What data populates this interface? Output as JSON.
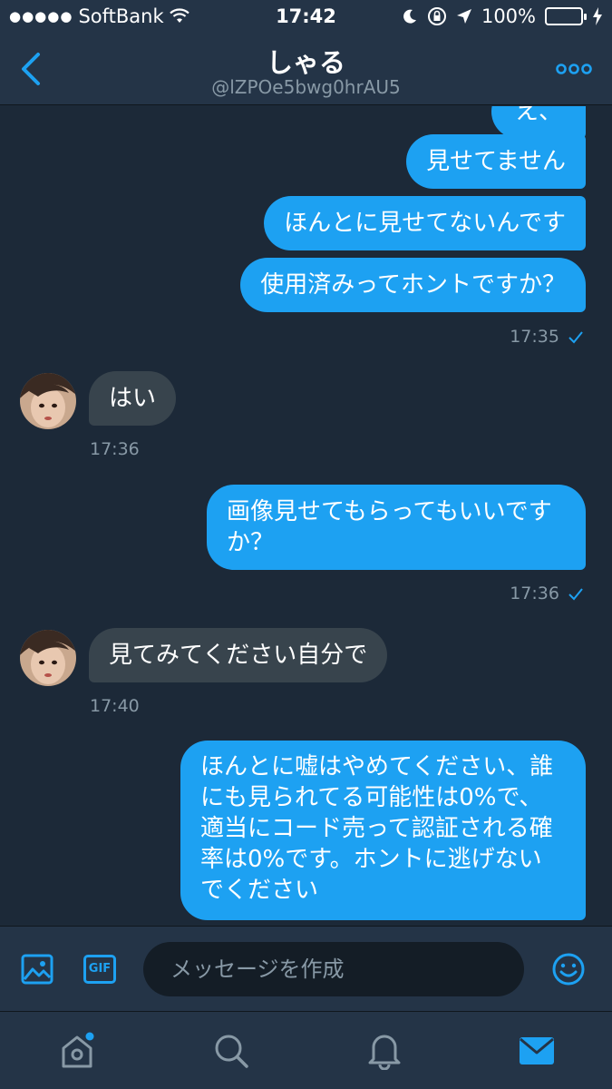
{
  "status_bar": {
    "carrier": "SoftBank",
    "time": "17:42",
    "battery": "100%"
  },
  "header": {
    "name": "しゃる",
    "handle": "@lZPOe5bwg0hrAU5"
  },
  "messages": {
    "m0": "え、",
    "m1": "見せてません",
    "m2": "ほんとに見せてないんです",
    "m3": "使用済みってホントですか？",
    "t1": "17:35",
    "m4": "はい",
    "t2": "17:36",
    "m5_line1": "画像見せてもらってもいいです",
    "m5_line2": "か？",
    "t3": "17:36",
    "m6": "見てみてください自分で",
    "t4": "17:40",
    "m7_line1": "ほんとに嘘はやめてください、誰",
    "m7_line2": "にも見られてる可能性は0%で、",
    "m7_line3": "適当にコード売って認証される確",
    "m7_line4": "率は0%です。ホントに逃げない",
    "m7_line5": "でください"
  },
  "compose": {
    "placeholder": "メッセージを作成",
    "gif_label": "GIF"
  },
  "colors": {
    "accent": "#1da1f2",
    "background": "#1c2938",
    "bar": "#243447",
    "received": "#38444d",
    "muted": "#8899a6"
  },
  "icons": [
    "back-chevron-icon",
    "more-dots-icon",
    "image-icon",
    "gif-icon",
    "emoji-icon",
    "home-icon",
    "search-icon",
    "bell-icon",
    "mail-icon"
  ]
}
